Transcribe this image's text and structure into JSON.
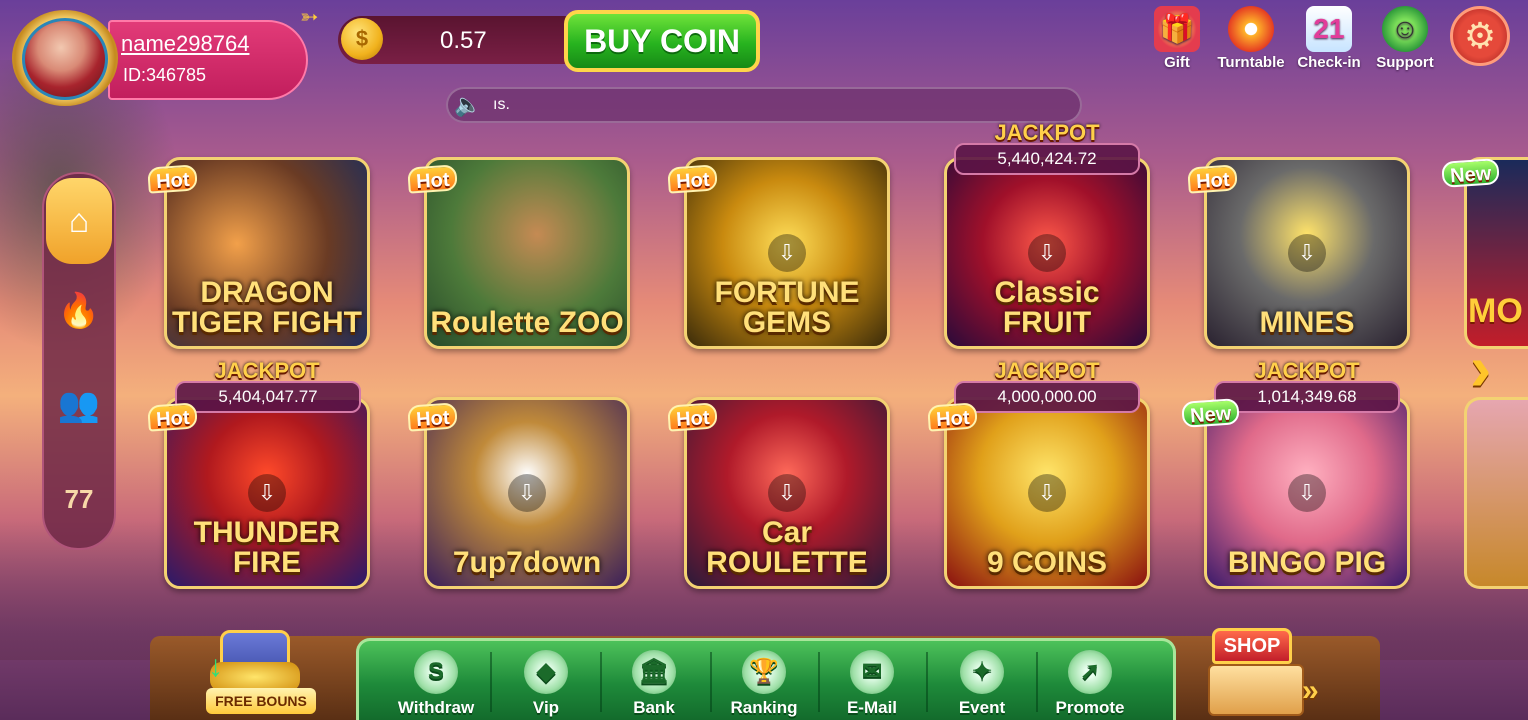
{
  "profile": {
    "username": "name298764",
    "id_label": "ID:346785"
  },
  "wallet": {
    "balance": "0.57",
    "buy_label": "BUY COIN"
  },
  "marquee": {
    "text": "ıs."
  },
  "top_icons": {
    "gift": "Gift",
    "turntable": "Turntable",
    "checkin": "Check-in",
    "support": "Support",
    "checkin_day": "21"
  },
  "games": [
    {
      "title": "DRAGON TIGER FIGHT",
      "badge": "Hot"
    },
    {
      "title": "Roulette ZOO",
      "badge": "Hot"
    },
    {
      "title": "FORTUNE GEMS",
      "badge": "Hot"
    },
    {
      "title": "Classic FRUIT",
      "badge": "",
      "jackpot_label": "JACKPOT",
      "jackpot": "5,440,424.72"
    },
    {
      "title": "MINES",
      "badge": "Hot"
    },
    {
      "title": "THUNDER FIRE",
      "badge": "Hot",
      "jackpot_label": "JACKPOT",
      "jackpot": "5,404,047.77"
    },
    {
      "title": "7up7down",
      "badge": "Hot"
    },
    {
      "title": "Car ROULETTE",
      "badge": "Hot"
    },
    {
      "title": "9 COINS",
      "badge": "Hot",
      "jackpot_label": "JACKPOT",
      "jackpot": "4,000,000.00"
    },
    {
      "title": "BINGO PIG",
      "badge": "New",
      "jackpot_label": "JACKPOT",
      "jackpot": "1,014,349.68"
    }
  ],
  "partial": {
    "badge": "New",
    "text": "MO"
  },
  "bottom_nav": {
    "free_bonus": "FREE BOUNS",
    "withdraw": "Withdraw",
    "vip": "Vip",
    "bank": "Bank",
    "ranking": "Ranking",
    "email": "E-Mail",
    "event": "Event",
    "promote": "Promote",
    "shop": "SHOP"
  },
  "colors": {
    "accent_green": "#27b31f",
    "badge_gold": "#ffd04a",
    "nav_green": "#1e8a3a"
  }
}
